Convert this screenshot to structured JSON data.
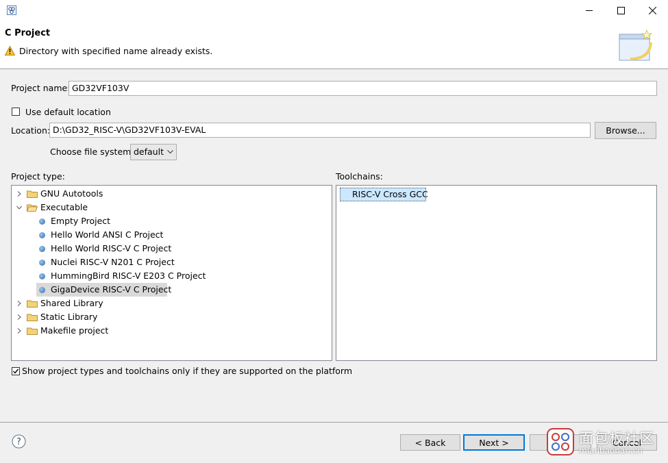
{
  "window": {
    "title": "",
    "controls": {
      "minimize": "minimize-icon",
      "maximize": "maximize-icon",
      "close": "close-icon"
    }
  },
  "banner": {
    "title": "C Project",
    "message": "Directory with specified name already exists.",
    "message_icon": "warning-icon"
  },
  "form": {
    "project_name_label": "Project name:",
    "project_name_value": "GD32VF103V",
    "use_default_location_label": "Use default location",
    "use_default_location_checked": false,
    "location_label": "Location:",
    "location_value": "D:\\GD32_RISC-V\\GD32VF103V-EVAL",
    "browse_label": "Browse...",
    "file_system_label": "Choose file system:",
    "file_system_value": "default"
  },
  "project_types": {
    "label": "Project type:",
    "items": [
      {
        "label": "GNU Autotools",
        "kind": "folder",
        "expanded": false
      },
      {
        "label": "Executable",
        "kind": "folder",
        "expanded": true
      },
      {
        "label": "Empty Project",
        "kind": "leaf"
      },
      {
        "label": "Hello World ANSI C Project",
        "kind": "leaf"
      },
      {
        "label": "Hello World RISC-V C Project",
        "kind": "leaf"
      },
      {
        "label": "Nuclei RISC-V N201 C Project",
        "kind": "leaf"
      },
      {
        "label": "HummingBird RISC-V E203 C Project",
        "kind": "leaf"
      },
      {
        "label": "GigaDevice RISC-V C Project",
        "kind": "leaf",
        "selected": true
      },
      {
        "label": "Shared Library",
        "kind": "folder",
        "expanded": false
      },
      {
        "label": "Static Library",
        "kind": "folder",
        "expanded": false
      },
      {
        "label": "Makefile project",
        "kind": "folder",
        "expanded": false
      }
    ]
  },
  "toolchains": {
    "label": "Toolchains:",
    "items": [
      {
        "label": "RISC-V Cross GCC",
        "selected": true
      }
    ]
  },
  "filter": {
    "label": "Show project types and toolchains only if they are supported on the platform",
    "checked": true
  },
  "footer": {
    "help_icon": "help-icon",
    "back_label": "< Back",
    "next_label": "Next >",
    "finish_label": "",
    "cancel_label": "Cancel"
  },
  "watermark": {
    "text_cn": "面包板社区",
    "text_en": "mianbaoban.cn"
  }
}
